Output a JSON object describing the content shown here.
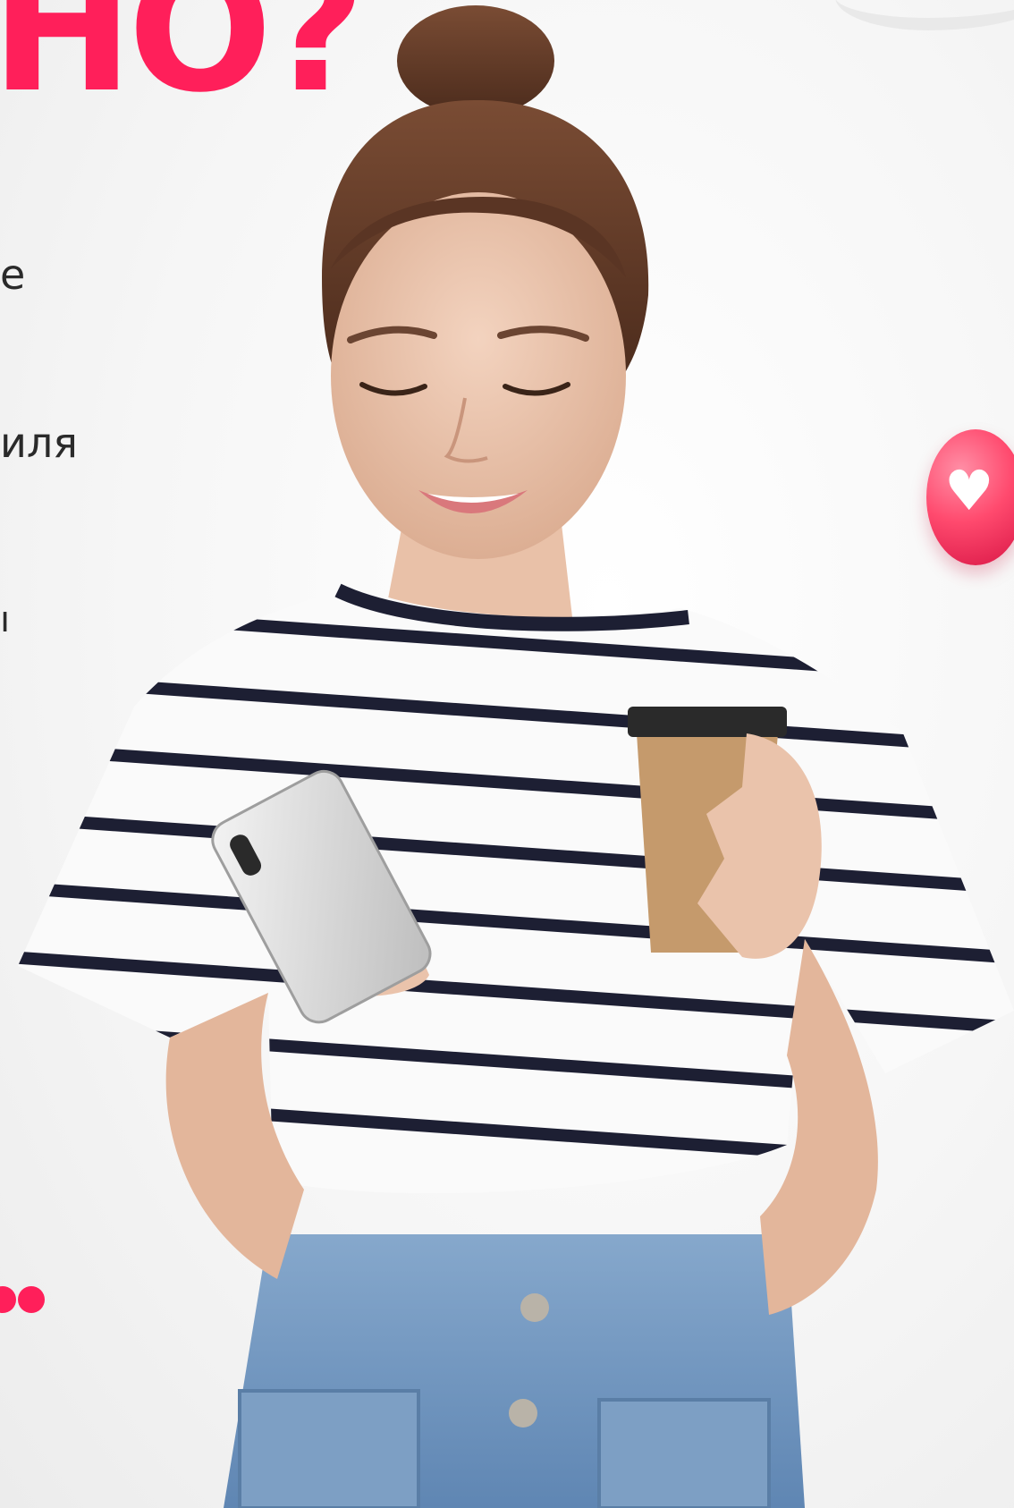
{
  "heading": {
    "text": "HO?"
  },
  "fragments": {
    "line_1": "e",
    "line_2": "иля",
    "line_3": "ı"
  },
  "colors": {
    "accent": "#ff1f5a",
    "text": "#2a2a2a",
    "background": "#f4f4f4"
  },
  "icons": {
    "heart_badge": "heart-icon",
    "slider_dots": "pagination-dots"
  }
}
